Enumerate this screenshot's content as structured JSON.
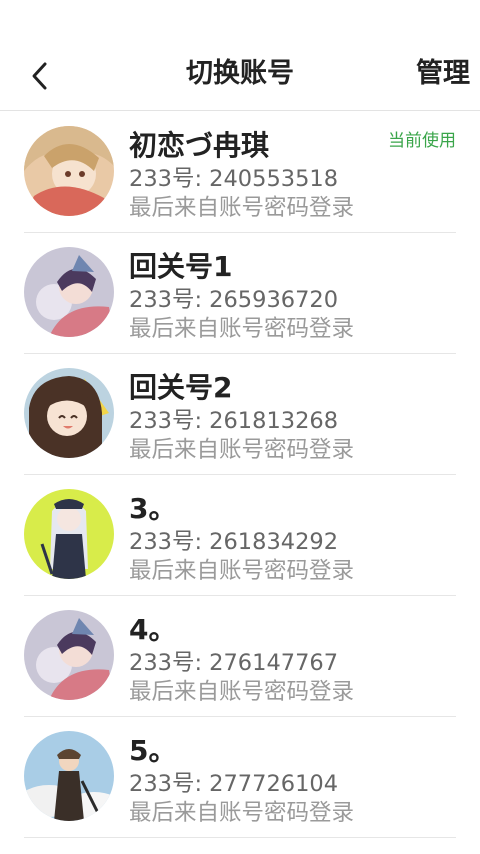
{
  "header": {
    "title": "切换账号",
    "manage_label": "管理",
    "back_icon": "chevron-left-icon"
  },
  "current_badge": "当前使用",
  "accounts": [
    {
      "name": "初恋づ冉琪",
      "uid": "233号: 240553518",
      "login": "最后来自账号密码登录",
      "current": true
    },
    {
      "name": "回关号1",
      "uid": "233号: 265936720",
      "login": "最后来自账号密码登录",
      "current": false
    },
    {
      "name": "回关号2",
      "uid": "233号: 261813268",
      "login": "最后来自账号密码登录",
      "current": false
    },
    {
      "name": "3。",
      "uid": "233号: 261834292",
      "login": "最后来自账号密码登录",
      "current": false
    },
    {
      "name": "4。",
      "uid": "233号: 276147767",
      "login": "最后来自账号密码登录",
      "current": false
    },
    {
      "name": "5。",
      "uid": "233号: 277726104",
      "login": "最后来自账号密码登录",
      "current": false
    }
  ],
  "colors": {
    "accent_green": "#3aa54a",
    "divider": "#e6e6e6",
    "secondary_text": "#666666",
    "tertiary_text": "#9a9a9a"
  }
}
